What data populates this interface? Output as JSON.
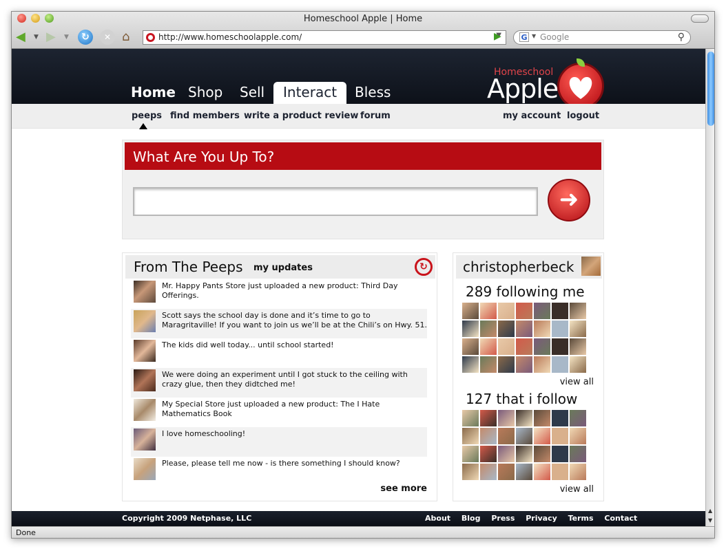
{
  "window": {
    "title": "Homeschool Apple | Home",
    "url": "http://www.homeschoolapple.com/",
    "search_placeholder": "Google",
    "status": "Done"
  },
  "header": {
    "tabs": [
      {
        "label": "Home",
        "active": false
      },
      {
        "label": "Shop",
        "active": false
      },
      {
        "label": "Sell",
        "active": false
      },
      {
        "label": "Interact",
        "active": true
      },
      {
        "label": "Bless",
        "active": false
      }
    ],
    "logo_small": "Homeschool",
    "logo_big": "Apple"
  },
  "subnav": {
    "peeps": "peeps",
    "find_members": "find members",
    "write_review": "write a product review",
    "forum": "forum",
    "my_account": "my account",
    "logout": "logout"
  },
  "status_box": {
    "title": "What Are You Up To?",
    "input_value": ""
  },
  "peeps": {
    "title": "From The Peeps",
    "tab": "my updates",
    "items": [
      {
        "text": "Mr. Happy Pants Store just uploaded a new product: Third Day Offerings.",
        "avatar": "avatar-1"
      },
      {
        "text": "Scott says the school day is done and it’s time to go to Maragritaville! If you want to join us we’ll be at the Chili’s on Hwy. 51.",
        "avatar": "avatar-2"
      },
      {
        "text": "The kids did well today... until school started!",
        "avatar": "avatar-3"
      },
      {
        "text": "We were doing an experiment until I got stuck to the ceiling with crazy glue, then they didtched me!",
        "avatar": "avatar-4"
      },
      {
        "text": "My Special Store just uploaded a new product: The I Hate Mathematics Book",
        "avatar": "avatar-5"
      },
      {
        "text": "I love homeschooling!",
        "avatar": "avatar-6"
      },
      {
        "text": "Please, please tell me now - is there something I should know?",
        "avatar": "avatar-7"
      }
    ],
    "see_more": "see more"
  },
  "profile": {
    "name": "christopherbeck",
    "following_me": "289 following me",
    "i_follow": "127 that i follow",
    "view_all": "view all"
  },
  "footer": {
    "copyright": "Copyright 2009 Netphase, LLC",
    "links": [
      "About",
      "Blog",
      "Press",
      "Privacy",
      "Terms",
      "Contact"
    ]
  },
  "colors": {
    "accent": "#b70c13",
    "header_bg": "#1d2431"
  }
}
